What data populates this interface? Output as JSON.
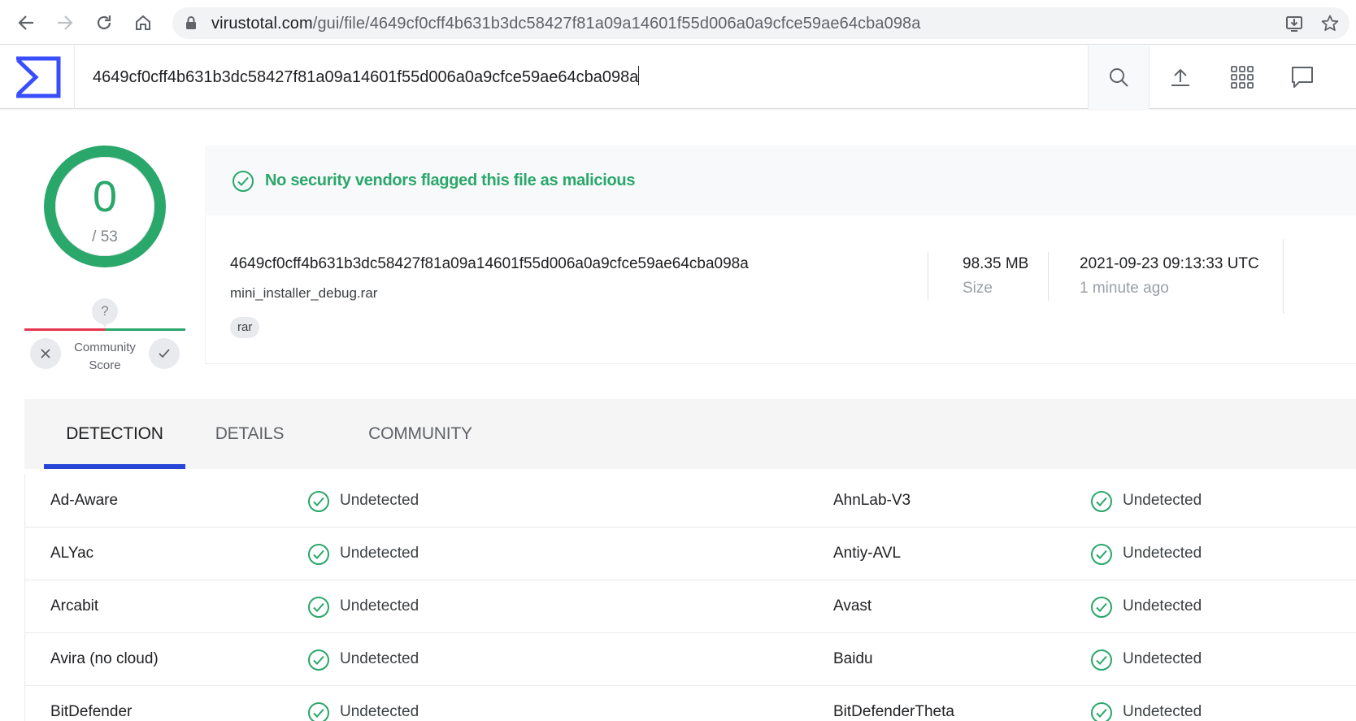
{
  "browser": {
    "url_host": "virustotal.com",
    "url_path": "/gui/file/4649cf0cff4b631b3dc58427f81a09a14601f55d006a0a9cfce59ae64cba098a"
  },
  "header": {
    "search_value": "4649cf0cff4b631b3dc58427f81a09a14601f55d006a0a9cfce59ae64cba098a"
  },
  "score": {
    "detections": "0",
    "total": "/ 53",
    "community_question": "?",
    "community_label_1": "Community",
    "community_label_2": "Score"
  },
  "verdict": {
    "text": "No security vendors flagged this file as malicious",
    "color": "#2aa76b"
  },
  "file": {
    "hash": "4649cf0cff4b631b3dc58427f81a09a14601f55d006a0a9cfce59ae64cba098a",
    "name": "mini_installer_debug.rar",
    "tag": "rar",
    "size": "98.35 MB",
    "size_label": "Size",
    "date": "2021-09-23 09:13:33 UTC",
    "ago": "1 minute ago"
  },
  "tabs": [
    {
      "label": "DETECTION"
    },
    {
      "label": "DETAILS"
    },
    {
      "label": "COMMUNITY"
    }
  ],
  "detections": [
    {
      "left": "Ad-Aware",
      "left_status": "Undetected",
      "right": "AhnLab-V3",
      "right_status": "Undetected"
    },
    {
      "left": "ALYac",
      "left_status": "Undetected",
      "right": "Antiy-AVL",
      "right_status": "Undetected"
    },
    {
      "left": "Arcabit",
      "left_status": "Undetected",
      "right": "Avast",
      "right_status": "Undetected"
    },
    {
      "left": "Avira (no cloud)",
      "left_status": "Undetected",
      "right": "Baidu",
      "right_status": "Undetected"
    },
    {
      "left": "BitDefender",
      "left_status": "Undetected",
      "right": "BitDefenderTheta",
      "right_status": "Undetected"
    }
  ],
  "colors": {
    "accent": "#2945d7",
    "clean": "#2aa76b",
    "malicious": "#e8354f"
  }
}
